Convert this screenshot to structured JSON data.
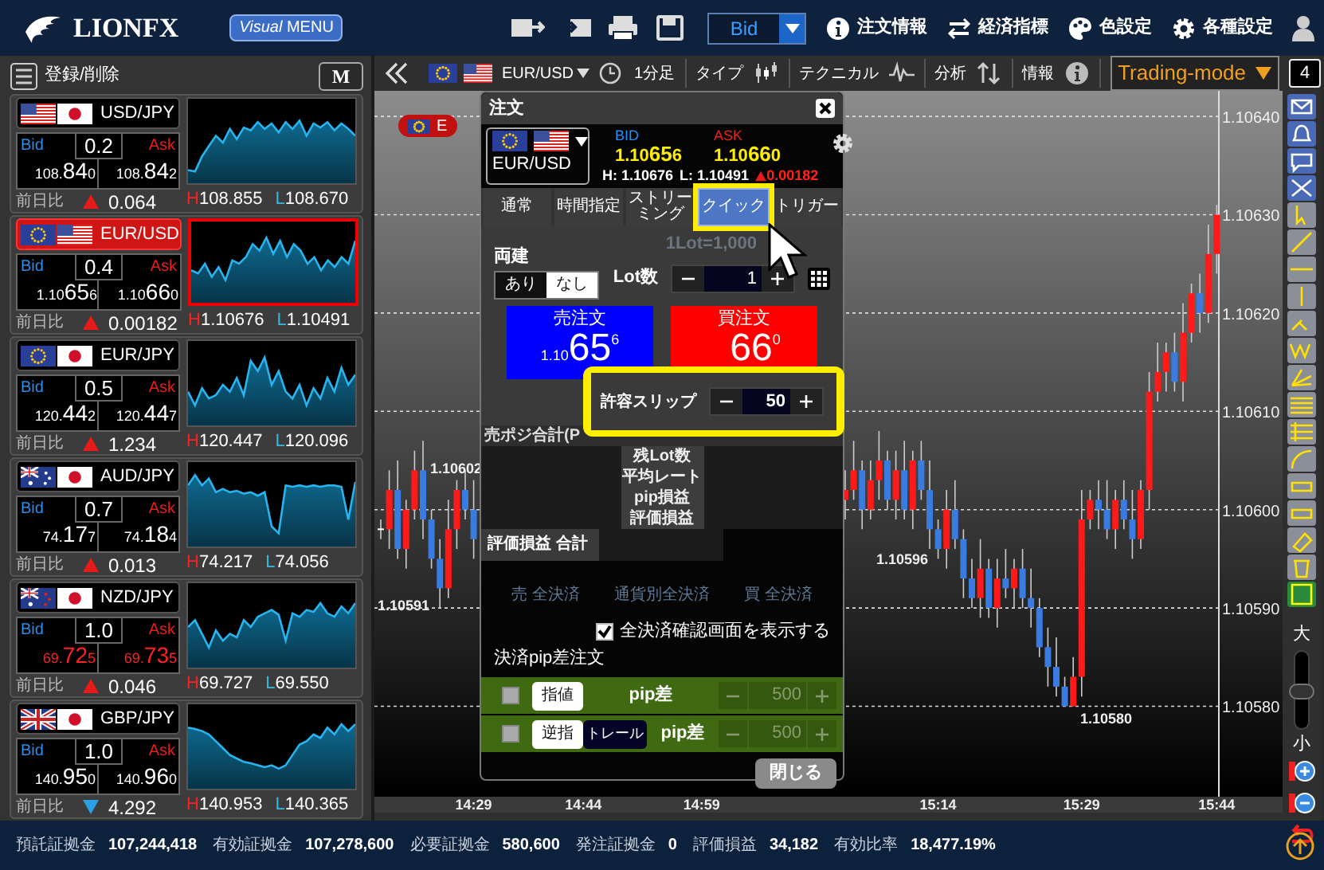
{
  "header": {
    "logo": "LIONFX",
    "menu_button": {
      "prefix": "Visual",
      "label": "MENU"
    },
    "price_type": "Bid",
    "menu": [
      {
        "kind": "info",
        "label": "注文情報"
      },
      {
        "kind": "exchange",
        "label": "経済指標"
      },
      {
        "kind": "palette",
        "label": "色設定"
      },
      {
        "kind": "gear",
        "label": "各種設定"
      }
    ]
  },
  "rate_panel": {
    "edit_label": "登録/削除",
    "mode_button": "M",
    "pairs": [
      {
        "pair": "USD/JPY",
        "flags": [
          {
            "kind": "us"
          },
          {
            "kind": "jp"
          }
        ],
        "selected": false,
        "bid_label": "Bid",
        "ask_label": "Ask",
        "spread": "0.2",
        "bid": {
          "pre": "108.",
          "big": "84",
          "small": "0"
        },
        "ask": {
          "pre": "108.",
          "big": "84",
          "small": "2"
        },
        "price_down": false,
        "change_label": "前日比",
        "change_up": true,
        "change": "0.064",
        "high_label": "H",
        "high": "108.855",
        "low_label": "L",
        "low": "108.670"
      },
      {
        "pair": "EUR/USD",
        "flags": [
          {
            "kind": "eu"
          },
          {
            "kind": "us"
          }
        ],
        "selected": true,
        "bid_label": "Bid",
        "ask_label": "Ask",
        "spread": "0.4",
        "bid": {
          "pre": "1.10",
          "big": "65",
          "small": "6"
        },
        "ask": {
          "pre": "1.10",
          "big": "66",
          "small": "0"
        },
        "price_down": false,
        "change_label": "前日比",
        "change_up": true,
        "change": "0.00182",
        "high_label": "H",
        "high": "1.10676",
        "low_label": "L",
        "low": "1.10491"
      },
      {
        "pair": "EUR/JPY",
        "flags": [
          {
            "kind": "eu"
          },
          {
            "kind": "jp"
          }
        ],
        "selected": false,
        "bid_label": "Bid",
        "ask_label": "Ask",
        "spread": "0.5",
        "bid": {
          "pre": "120.",
          "big": "44",
          "small": "2"
        },
        "ask": {
          "pre": "120.",
          "big": "44",
          "small": "7"
        },
        "price_down": false,
        "change_label": "前日比",
        "change_up": true,
        "change": "1.234",
        "high_label": "H",
        "high": "120.447",
        "low_label": "L",
        "low": "120.096"
      },
      {
        "pair": "AUD/JPY",
        "flags": [
          {
            "kind": "au"
          },
          {
            "kind": "jp"
          }
        ],
        "selected": false,
        "bid_label": "Bid",
        "ask_label": "Ask",
        "spread": "0.7",
        "bid": {
          "pre": "74.",
          "big": "17",
          "small": "7"
        },
        "ask": {
          "pre": "74.",
          "big": "18",
          "small": "4"
        },
        "price_down": false,
        "change_label": "前日比",
        "change_up": true,
        "change": "0.013",
        "high_label": "H",
        "high": "74.217",
        "low_label": "L",
        "low": "74.056"
      },
      {
        "pair": "NZD/JPY",
        "flags": [
          {
            "kind": "nz"
          },
          {
            "kind": "jp"
          }
        ],
        "selected": false,
        "bid_label": "Bid",
        "ask_label": "Ask",
        "spread": "1.0",
        "bid": {
          "pre": "69.",
          "big": "72",
          "small": "5"
        },
        "ask": {
          "pre": "69.",
          "big": "73",
          "small": "5"
        },
        "price_down": true,
        "change_label": "前日比",
        "change_up": true,
        "change": "0.046",
        "high_label": "H",
        "high": "69.727",
        "low_label": "L",
        "low": "69.550"
      },
      {
        "pair": "GBP/JPY",
        "flags": [
          {
            "kind": "gb"
          },
          {
            "kind": "jp"
          }
        ],
        "selected": false,
        "bid_label": "Bid",
        "ask_label": "Ask",
        "spread": "1.0",
        "bid": {
          "pre": "140.",
          "big": "95",
          "small": "0"
        },
        "ask": {
          "pre": "140.",
          "big": "96",
          "small": "0"
        },
        "price_down": false,
        "change_label": "前日比",
        "change_up": false,
        "change": "4.292",
        "high_label": "H",
        "high": "140.953",
        "low_label": "L",
        "low": "140.365"
      }
    ]
  },
  "chart": {
    "pair": "EUR/USD",
    "flags": [
      {
        "kind": "eu"
      },
      {
        "kind": "us"
      }
    ],
    "timeframe": "1分足",
    "toolbar": [
      {
        "kind": "type",
        "label": "タイプ"
      },
      {
        "kind": "technical",
        "label": "テクニカル"
      },
      {
        "kind": "analysis",
        "label": "分析"
      },
      {
        "kind": "info",
        "label": "情報"
      }
    ],
    "mode": "Trading-mode",
    "layout_count": "4",
    "tag": "E",
    "chart_data": {
      "type": "candlestick",
      "categories": [
        null,
        null,
        null,
        null,
        null,
        null,
        null,
        null,
        null,
        null,
        null,
        "14:29",
        null,
        null,
        null,
        null,
        null,
        null,
        null,
        null,
        null,
        null,
        null,
        null,
        "14:44",
        null,
        null,
        null,
        null,
        null,
        null,
        null,
        null,
        null,
        null,
        null,
        null,
        null,
        "14:59",
        null,
        null,
        null,
        null,
        null,
        null,
        null,
        null,
        null,
        null,
        null,
        null,
        null,
        null,
        null,
        null,
        null,
        null,
        null,
        null,
        null,
        null,
        null,
        null,
        null,
        null,
        null,
        "15:14",
        null,
        null,
        null,
        null,
        null,
        null,
        null,
        null,
        null,
        null,
        null,
        null,
        null,
        null,
        null,
        null,
        "15:29",
        null,
        null,
        null,
        null,
        null,
        null,
        null,
        null,
        null,
        null,
        null,
        null,
        null,
        null,
        null,
        "15:44"
      ],
      "ylim": [
        1.105708,
        1.106426
      ],
      "grid": true,
      "ohlc": [
        [
          1.10598,
          1.10599,
          1.10597,
          1.10598
        ],
        [
          1.10598,
          1.10604,
          1.10596,
          1.10602
        ],
        [
          1.10602,
          1.10605,
          1.10595,
          1.10596
        ],
        [
          1.10596,
          1.10601,
          1.10594,
          1.106
        ],
        [
          1.106,
          1.10606,
          1.10599,
          1.10604
        ],
        [
          1.10604,
          1.10607,
          1.10597,
          1.10599
        ],
        [
          1.10599,
          1.106,
          1.10594,
          1.10595
        ],
        [
          1.10595,
          1.10597,
          1.1059,
          1.10592
        ],
        [
          1.10592,
          1.10601,
          1.10591,
          1.10598
        ],
        [
          1.10598,
          1.10603,
          1.10596,
          1.10602
        ],
        [
          1.10602,
          1.10604,
          1.10599,
          1.106
        ],
        [
          1.106,
          1.10603,
          1.10595,
          1.10597
        ],
        null,
        null,
        null,
        null,
        null,
        null,
        null,
        null,
        null,
        null,
        null,
        null,
        null,
        null,
        null,
        null,
        null,
        null,
        null,
        null,
        null,
        null,
        null,
        null,
        null,
        null,
        null,
        null,
        null,
        null,
        null,
        null,
        null,
        null,
        null,
        null,
        null,
        null,
        null,
        null,
        null,
        null,
        null,
        [
          1.10601,
          1.10604,
          1.10599,
          1.10602
        ],
        [
          1.10602,
          1.10607,
          1.10601,
          1.10604
        ],
        [
          1.10604,
          1.10605,
          1.10598,
          1.106
        ],
        [
          1.106,
          1.10605,
          1.10599,
          1.10603
        ],
        [
          1.10603,
          1.10608,
          1.10601,
          1.10605
        ],
        [
          1.10605,
          1.10606,
          1.106,
          1.10601
        ],
        [
          1.10601,
          1.10606,
          1.10599,
          1.10604
        ],
        [
          1.10604,
          1.10607,
          1.10599,
          1.106
        ],
        [
          1.106,
          1.10606,
          1.10598,
          1.10605
        ],
        [
          1.10605,
          1.10607,
          1.10601,
          1.10602
        ],
        [
          1.10602,
          1.10605,
          1.10596,
          1.10598
        ],
        [
          1.10598,
          1.10599,
          1.10595,
          1.10596
        ],
        [
          1.10596,
          1.10602,
          1.10594,
          1.106
        ],
        [
          1.106,
          1.10603,
          1.10596,
          1.10597
        ],
        [
          1.10597,
          1.10598,
          1.10591,
          1.10593
        ],
        [
          1.10593,
          1.10595,
          1.1059,
          1.10591
        ],
        [
          1.10591,
          1.10597,
          1.10589,
          1.10594
        ],
        [
          1.10594,
          1.10595,
          1.10589,
          1.1059
        ],
        [
          1.1059,
          1.10595,
          1.10588,
          1.10593
        ],
        [
          1.10593,
          1.10596,
          1.10591,
          1.10592
        ],
        [
          1.10592,
          1.10595,
          1.1059,
          1.10594
        ],
        [
          1.10594,
          1.10596,
          1.1059,
          1.10591
        ],
        [
          1.10591,
          1.10594,
          1.10588,
          1.1059
        ],
        [
          1.1059,
          1.10591,
          1.10585,
          1.10586
        ],
        [
          1.10586,
          1.10588,
          1.10582,
          1.10584
        ],
        [
          1.10584,
          1.10587,
          1.10581,
          1.10582
        ],
        [
          1.10582,
          1.10583,
          1.1058,
          1.1058
        ],
        [
          1.1058,
          1.10585,
          1.1058,
          1.10583
        ],
        [
          1.10583,
          1.10602,
          1.10581,
          1.10599
        ],
        [
          1.10599,
          1.10602,
          1.10598,
          1.10601
        ],
        [
          1.10601,
          1.10603,
          1.10598,
          1.106
        ],
        [
          1.106,
          1.10603,
          1.10597,
          1.10598
        ],
        [
          1.10598,
          1.10602,
          1.10596,
          1.10601
        ],
        [
          1.10601,
          1.10603,
          1.10598,
          1.10599
        ],
        [
          1.10599,
          1.10602,
          1.10595,
          1.10597
        ],
        [
          1.10597,
          1.10603,
          1.10596,
          1.10602
        ],
        [
          1.10602,
          1.10614,
          1.106,
          1.10612
        ],
        [
          1.10612,
          1.10617,
          1.10611,
          1.10614
        ],
        [
          1.10614,
          1.10617,
          1.10612,
          1.10616
        ],
        [
          1.10616,
          1.10618,
          1.10612,
          1.10613
        ],
        [
          1.10613,
          1.10621,
          1.10611,
          1.10618
        ],
        [
          1.10618,
          1.10623,
          1.10617,
          1.10622
        ],
        [
          1.10622,
          1.10624,
          1.10618,
          1.1062
        ],
        [
          1.1062,
          1.10629,
          1.10619,
          1.10626
        ],
        [
          1.10626,
          1.10631,
          1.10624,
          1.1063
        ]
      ],
      "yticks": [
        {
          "value": 1.1064,
          "label": "1.10640"
        },
        {
          "value": 1.1063,
          "label": "1.10630"
        },
        {
          "value": 1.1062,
          "label": "1.10620"
        },
        {
          "value": 1.1061,
          "label": "1.10610"
        },
        {
          "value": 1.106,
          "label": "1.10600"
        },
        {
          "value": 1.1059,
          "label": "1.10590"
        },
        {
          "value": 1.1058,
          "label": "1.10580"
        }
      ],
      "annotations": [
        "1.10602",
        "1.10591",
        "1.10596",
        "1.10580"
      ]
    },
    "zoom": {
      "large_label": "大",
      "small_label": "小",
      "level": 0.5
    }
  },
  "order_dialog": {
    "title": "注文",
    "pair": "EUR/USD",
    "flags": [
      {
        "kind": "eu"
      },
      {
        "kind": "us"
      }
    ],
    "bid_label": "BID",
    "ask_label": "ASK",
    "bid": {
      "pre": "1.10",
      "big": "65",
      "small": "6"
    },
    "ask": {
      "pre": "1.10",
      "big": "66",
      "small": "0"
    },
    "high": "H: 1.10676",
    "low": "L: 1.10491",
    "change": "0.00182",
    "change_up": true,
    "tabs": [
      {
        "label": "通常",
        "selected": false,
        "highlighted": false
      },
      {
        "label": "時間指定",
        "selected": false,
        "highlighted": false
      },
      {
        "label": "ストリーミング",
        "selected": false,
        "highlighted": false
      },
      {
        "label": "クイック",
        "selected": true,
        "highlighted": true
      },
      {
        "label": "トリガー",
        "selected": false,
        "highlighted": false
      }
    ],
    "hedge_label": "両建",
    "hedge_options": [
      {
        "label": "あり",
        "selected": false
      },
      {
        "label": "なし",
        "selected": true
      }
    ],
    "lot_unit": "1Lot=1,000",
    "lot_label": "Lot数",
    "lot_value": "1",
    "sell": {
      "label": "売注文",
      "pre": "1.10",
      "big": "65",
      "sup": "6"
    },
    "buy": {
      "label": "買注文",
      "big": "66",
      "sup": "0"
    },
    "slippage": {
      "label": "許容スリップ",
      "value": "50",
      "highlighted": true
    },
    "position_title": "売ポジ合計(P",
    "position_rows": [
      "残Lot数",
      "平均レート",
      "pip損益",
      "評価損益"
    ],
    "total_label": "評価損益 合計",
    "settle_buttons": [
      {
        "label": "売 全決済",
        "disabled": true
      },
      {
        "label": "通貨別全決済",
        "disabled": true
      },
      {
        "label": "買 全決済",
        "disabled": true
      }
    ],
    "confirm": {
      "label": "全決済確認画面を表示する",
      "checked": true
    },
    "pip_title": "決済pip差注文",
    "pip_orders": [
      {
        "checked": false,
        "type_label": "指値",
        "unit_label": "pip差",
        "value": "500",
        "disabled": true
      },
      {
        "checked": false,
        "type_label": "逆指",
        "trail_label": "トレール",
        "unit_label": "pip差",
        "value": "500",
        "disabled": true
      }
    ],
    "close_button": "閉じる"
  },
  "status_bar": [
    {
      "label": "預託証拠金",
      "value": "107,244,418"
    },
    {
      "label": "有効証拠金",
      "value": "107,278,600"
    },
    {
      "label": "必要証拠金",
      "value": "580,600"
    },
    {
      "label": "発注証拠金",
      "value": "0"
    },
    {
      "label": "評価損益",
      "value": "34,182"
    },
    {
      "label": "有効比率",
      "value": "18,477.19%"
    }
  ]
}
